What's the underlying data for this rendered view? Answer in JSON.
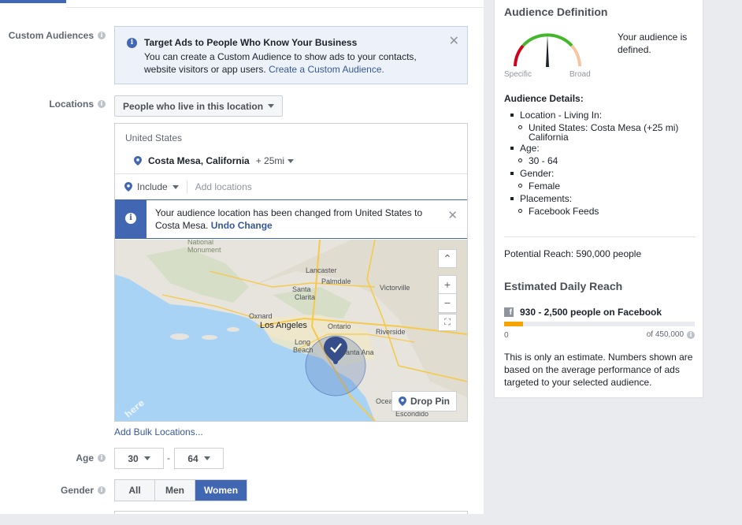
{
  "custom_audiences": {
    "label": "Custom Audiences",
    "info_title": "Target Ads to People Who Know Your Business",
    "info_text": "You can create a Custom Audience to show ads to your contacts, website visitors or app users.",
    "info_link": "Create a Custom Audience.",
    "close": "✕"
  },
  "locations": {
    "label": "Locations",
    "type_dropdown": "People who live in this location",
    "country": "United States",
    "city": "Costa Mesa, California",
    "radius": "+ 25mi",
    "include_label": "Include",
    "add_placeholder": "Add locations",
    "notice_text": "Your audience location has been changed from United States to Costa Mesa.",
    "notice_link": "Undo Change",
    "notice_close": "✕",
    "map": {
      "labels": [
        "National Monument",
        "Lancaster",
        "Palmdale",
        "Santa Clarita",
        "Victorville",
        "Oxnard",
        "Los Angeles",
        "Ontario",
        "Riverside",
        "Long Beach",
        "Santa Ana",
        "Ocea",
        "Escondido"
      ],
      "zoom_in": "+",
      "zoom_out": "−",
      "watermark": "here",
      "drop_pin": "Drop Pin"
    },
    "bulk_link": "Add Bulk Locations..."
  },
  "age": {
    "label": "Age",
    "min": "30",
    "max": "64",
    "separator": "-"
  },
  "gender": {
    "label": "Gender",
    "options": [
      "All",
      "Men",
      "Women"
    ],
    "selected": "Women"
  },
  "sidebar": {
    "definition_title": "Audience Definition",
    "gauge_left": "Specific",
    "gauge_right": "Broad",
    "defined_text": "Your audience is defined.",
    "details_title": "Audience Details:",
    "details": {
      "location_label": "Location - Living In:",
      "location_value": "United States: Costa Mesa (+25 mi) California",
      "age_label": "Age:",
      "age_value": "30 - 64",
      "gender_label": "Gender:",
      "gender_value": "Female",
      "placements_label": "Placements:",
      "placements_value": "Facebook Feeds"
    },
    "potential_reach": "Potential Reach: 590,000 people",
    "estimated_title": "Estimated Daily Reach",
    "fb_reach": "930 - 2,500 people on Facebook",
    "bar_min": "0",
    "bar_max": "of 450,000",
    "bar_fill_fraction": 0.1,
    "estimate_note": "This is only an estimate. Numbers shown are based on the average performance of ads targeted to your selected audience."
  },
  "colors": {
    "accent": "#4267b2",
    "link": "#365899",
    "bar": "#f7a400",
    "gauge_green": "#42b72a",
    "gauge_red": "#d0021b",
    "gauge_orange": "#f7c59f"
  }
}
